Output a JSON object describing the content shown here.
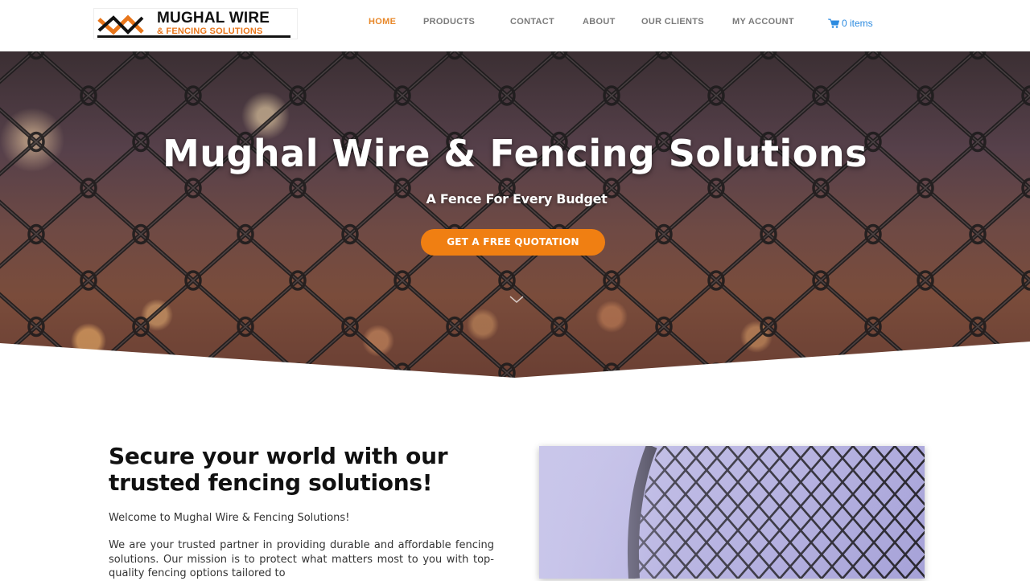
{
  "brand": {
    "title": "MUGHAL WIRE",
    "subtitle": "& FENCING SOLUTIONS"
  },
  "nav": {
    "items": [
      {
        "label": "HOME",
        "active": true
      },
      {
        "label": "PRODUCTS",
        "active": false
      },
      {
        "label": "CONTACT",
        "active": false
      },
      {
        "label": "ABOUT",
        "active": false
      },
      {
        "label": "OUR CLIENTS",
        "active": false
      },
      {
        "label": "MY ACCOUNT",
        "active": false
      }
    ],
    "cart": {
      "label": "0 items",
      "icon": "cart-icon"
    }
  },
  "hero": {
    "title": "Mughal Wire & Fencing Solutions",
    "subtitle": "A Fence For Every Budget",
    "cta_label": "GET A FREE QUOTATION",
    "scroll_icon": "chevron-down-icon"
  },
  "intro": {
    "heading": "Secure your world with our trusted fencing solutions!",
    "welcome": "Welcome to Mughal Wire & Fencing Solutions!",
    "paragraph": "We are your trusted partner in providing durable and affordable fencing solutions. Our mission is to protect what matters most to you with top-quality fencing options tailored to"
  },
  "colors": {
    "accent": "#f07f12",
    "nav_active": "#e8882a",
    "cart": "#2c8be0",
    "text_dark": "#111111"
  }
}
